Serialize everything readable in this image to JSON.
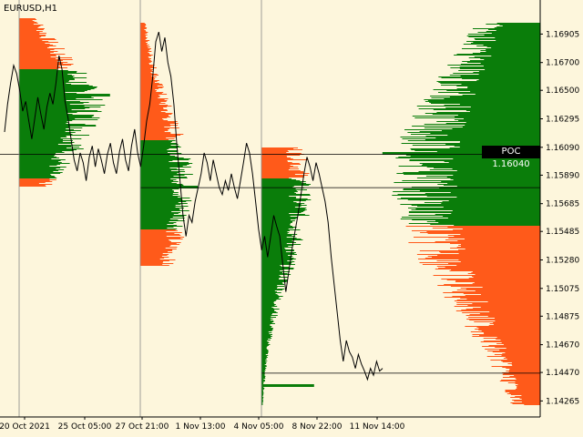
{
  "symbol": "EURUSD,H1",
  "poc_label": "POC 1.16040",
  "colors": {
    "background": "#fdf6dc",
    "volume_up": "#0a7d0a",
    "volume_down": "#ff5a1a",
    "price_line": "#000000",
    "grid": "#000000"
  },
  "chart_data": {
    "type": "line",
    "title": "",
    "xlabel": "",
    "ylabel": "",
    "ylim": [
      1.1415,
      1.1715
    ],
    "y_ticks": [
      "1.16905",
      "1.16700",
      "1.16500",
      "1.16295",
      "1.16090",
      "1.15890",
      "1.15685",
      "1.15485",
      "1.15280",
      "1.15075",
      "1.14875",
      "1.14670",
      "1.14470",
      "1.14265"
    ],
    "x_ticks": [
      "20 Oct 2021",
      "25 Oct 05:00",
      "27 Oct 21:00",
      "1 Nov 13:00",
      "4 Nov 05:00",
      "8 Nov 22:00",
      "11 Nov 14:00"
    ],
    "session_dividers": [
      "20 Oct 2021",
      "27 Oct 21:00",
      "4 Nov 05:00"
    ],
    "poc_price": 1.1604,
    "horizontal_levels": [
      1.1604,
      1.158,
      1.14465
    ],
    "series": [
      {
        "values": [
          1.162,
          1.164,
          1.1655,
          1.1668,
          1.1662,
          1.165,
          1.1635,
          1.1642,
          1.1628,
          1.1615,
          1.163,
          1.1645,
          1.1633,
          1.1622,
          1.1638,
          1.1648,
          1.164,
          1.1655,
          1.1675,
          1.1665,
          1.1642,
          1.163,
          1.1615,
          1.16,
          1.1592,
          1.1605,
          1.1598,
          1.1585,
          1.1602,
          1.161,
          1.1595,
          1.1608,
          1.16,
          1.159,
          1.1604,
          1.1612,
          1.1598,
          1.159,
          1.1606,
          1.1615,
          1.16,
          1.1592,
          1.161,
          1.1622,
          1.1605,
          1.1595,
          1.161,
          1.1628,
          1.164,
          1.166,
          1.1685,
          1.1692,
          1.1678,
          1.1688,
          1.167,
          1.166,
          1.164,
          1.161,
          1.1585,
          1.156,
          1.1545,
          1.156,
          1.1555,
          1.157,
          1.158,
          1.159,
          1.1605,
          1.1598,
          1.1585,
          1.16,
          1.159,
          1.158,
          1.1575,
          1.1585,
          1.1578,
          1.159,
          1.158,
          1.1572,
          1.1585,
          1.1598,
          1.1612,
          1.1605,
          1.159,
          1.157,
          1.155,
          1.1535,
          1.1545,
          1.153,
          1.1545,
          1.156,
          1.1552,
          1.1545,
          1.1525,
          1.1505,
          1.152,
          1.1535,
          1.1548,
          1.156,
          1.1575,
          1.159,
          1.1602,
          1.1595,
          1.1585,
          1.1598,
          1.159,
          1.158,
          1.157,
          1.1555,
          1.153,
          1.151,
          1.149,
          1.147,
          1.1455,
          1.147,
          1.1462,
          1.1458,
          1.145,
          1.146,
          1.1453,
          1.1448,
          1.1442,
          1.145,
          1.1445,
          1.1455,
          1.1448,
          1.145
        ]
      }
    ]
  }
}
